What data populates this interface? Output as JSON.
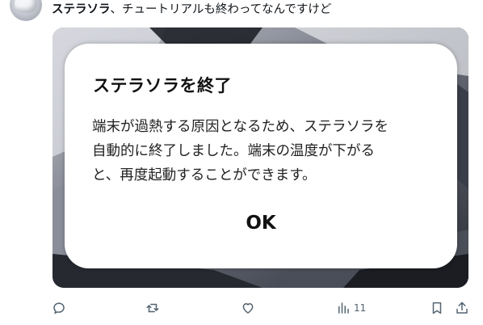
{
  "post": {
    "author": "ステラソラ",
    "text": "、チュートリアルも終わってなんですけど"
  },
  "dialog": {
    "title": "ステラソラを終了",
    "body": "端末が過熱する原因となるため、ステラソラを\n自動的に終了しました。端末の温度が下がる\nと、再度起動することができます。",
    "ok_label": "OK"
  },
  "actions": {
    "reply_icon": "reply-icon",
    "repost_icon": "repost-icon",
    "like_icon": "like-icon",
    "views_icon": "views-icon",
    "views_count": "11",
    "bookmark_icon": "bookmark-icon",
    "share_icon": "share-icon"
  },
  "colors": {
    "text": "#0f1419",
    "muted": "#536471",
    "dialog_bg": "#ffffff"
  }
}
